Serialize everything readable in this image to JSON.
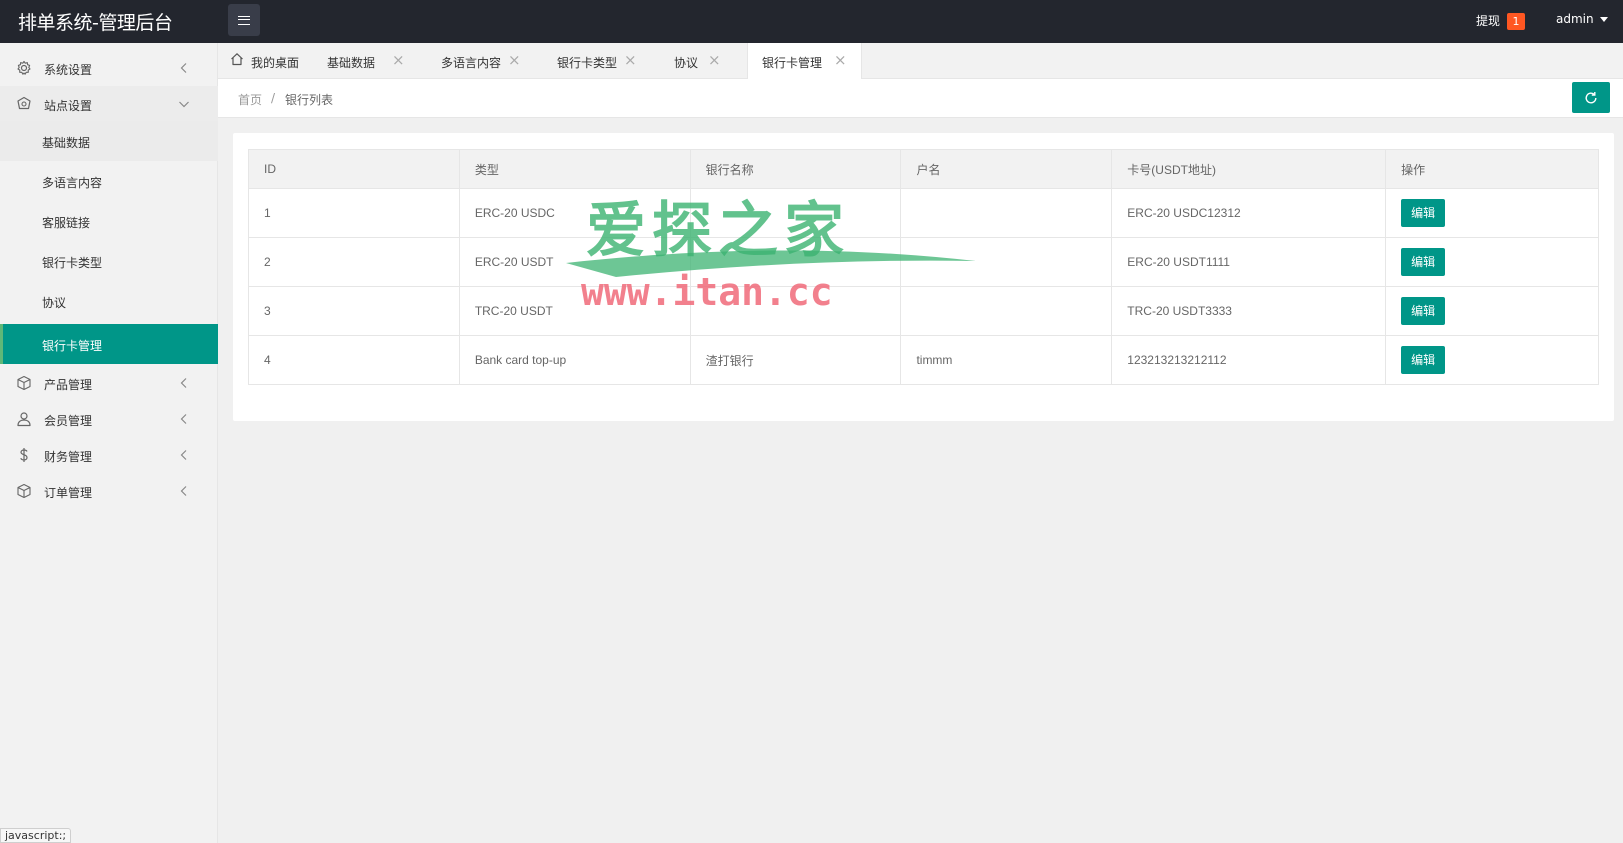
{
  "header": {
    "title": "排单系统-管理后台",
    "withdraw_label": "提现",
    "withdraw_badge": "1",
    "user_label": "admin"
  },
  "sidebar": {
    "items": [
      {
        "label": "系统设置",
        "icon": "gear-icon",
        "expanded": false
      },
      {
        "label": "站点设置",
        "icon": "site-icon",
        "expanded": true
      },
      {
        "label": "产品管理",
        "icon": "box-icon",
        "expanded": false
      },
      {
        "label": "会员管理",
        "icon": "user-icon",
        "expanded": false
      },
      {
        "label": "财务管理",
        "icon": "dollar-icon",
        "expanded": false
      },
      {
        "label": "订单管理",
        "icon": "box-icon",
        "expanded": false
      }
    ],
    "sub_items": [
      {
        "label": "基础数据"
      },
      {
        "label": "多语言内容"
      },
      {
        "label": "客服链接"
      },
      {
        "label": "银行卡类型"
      },
      {
        "label": "协议"
      },
      {
        "label": "银行卡管理",
        "active": true
      }
    ]
  },
  "tabs": [
    {
      "label": "我的桌面",
      "closable": false
    },
    {
      "label": "基础数据",
      "closable": true
    },
    {
      "label": "多语言内容",
      "closable": true
    },
    {
      "label": "银行卡类型",
      "closable": true
    },
    {
      "label": "协议",
      "closable": true
    },
    {
      "label": "银行卡管理",
      "closable": true,
      "active": true
    }
  ],
  "breadcrumb": {
    "home": "首页",
    "separator": "/",
    "current": "银行列表"
  },
  "table": {
    "columns": [
      "ID",
      "类型",
      "银行名称",
      "户名",
      "卡号(USDT地址)",
      "操作"
    ],
    "rows": [
      {
        "id": "1",
        "type": "ERC-20 USDC",
        "bank": "",
        "holder": "",
        "card": "ERC-20 USDC12312",
        "action": "编辑"
      },
      {
        "id": "2",
        "type": "ERC-20 USDT",
        "bank": "",
        "holder": "",
        "card": "ERC-20 USDT1111",
        "action": "编辑"
      },
      {
        "id": "3",
        "type": "TRC-20 USDT",
        "bank": "",
        "holder": "",
        "card": "TRC-20 USDT3333",
        "action": "编辑"
      },
      {
        "id": "4",
        "type": "Bank card top-up",
        "bank": "渣打银行",
        "holder": "timmm",
        "card": "123213213212112",
        "action": "编辑"
      }
    ]
  },
  "watermark": {
    "line1": "爱探之家",
    "line2": "www.itan.cc"
  },
  "statusbar": {
    "text": "javascript:;"
  },
  "colors": {
    "accent": "#009688",
    "header_bg": "#23262e",
    "badge": "#ff5722",
    "watermark_green": "#3cb371",
    "watermark_pink": "#f06a7a"
  }
}
